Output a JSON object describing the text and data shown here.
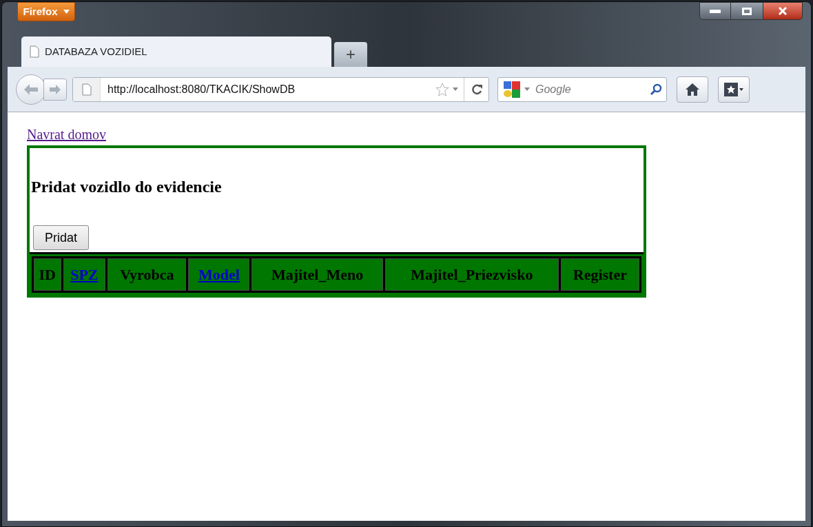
{
  "app_button": {
    "label": "Firefox"
  },
  "tabs": [
    {
      "title": "DATABAZA VOZIDIEL",
      "selected": true
    }
  ],
  "new_tab": {
    "label": "+"
  },
  "address_bar": {
    "url": "http://localhost:8080/TKACIK/ShowDB"
  },
  "search_bar": {
    "placeholder": "Google"
  },
  "page": {
    "home_link": "Navrat domov",
    "heading": "Pridat vozidlo do evidencie",
    "add_button": "Pridat",
    "columns": [
      {
        "label": "ID",
        "kind": "text"
      },
      {
        "label": "SPZ",
        "kind": "link"
      },
      {
        "label": "Vyrobca",
        "kind": "text"
      },
      {
        "label": "Model",
        "kind": "link"
      },
      {
        "label": "Majitel_Meno",
        "kind": "text"
      },
      {
        "label": "Majitel_Priezvisko",
        "kind": "text"
      },
      {
        "label": "Register",
        "kind": "text"
      }
    ]
  }
}
